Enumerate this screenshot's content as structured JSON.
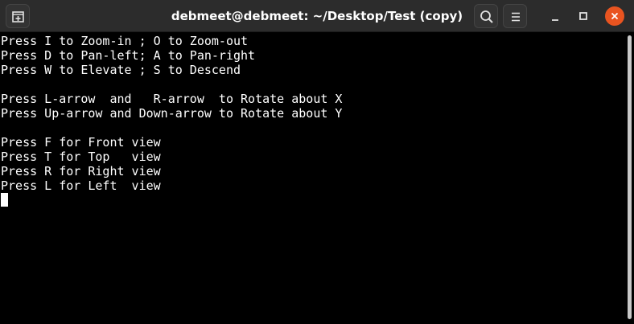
{
  "window": {
    "title": "debmeet@debmeet: ~/Desktop/Test (copy)"
  },
  "titlebar": {
    "new_tab_icon": "new-tab-icon",
    "search_icon": "search-icon",
    "menu_icon": "hamburger-menu-icon",
    "minimize_icon": "minimize-icon",
    "maximize_icon": "maximize-icon",
    "close_icon": "close-icon",
    "close_color": "#e95420"
  },
  "terminal": {
    "lines": [
      "Press I to Zoom-in ; O to Zoom-out",
      "Press D to Pan-left; A to Pan-right",
      "Press W to Elevate ; S to Descend",
      "",
      "Press L-arrow  and   R-arrow  to Rotate about X",
      "Press Up-arrow and Down-arrow to Rotate about Y",
      "",
      "Press F for Front view",
      "Press T for Top   view",
      "Press R for Right view",
      "Press L for Left  view"
    ],
    "foreground": "#ffffff",
    "background": "#000000"
  }
}
